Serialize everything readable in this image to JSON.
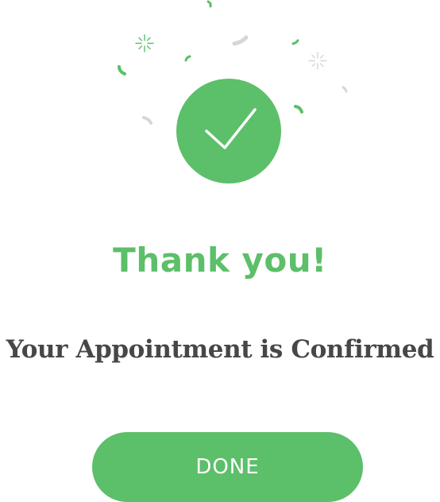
{
  "theme": {
    "accent": "#5cbf69",
    "text": "#474747",
    "confetti_gray": "#d6d6d6",
    "background": "#ffffff"
  },
  "success_icon": "checkmark-icon",
  "title": "Thank you!",
  "message": "Your Appointment is Confirmed",
  "done_button": {
    "label": "DONE"
  }
}
